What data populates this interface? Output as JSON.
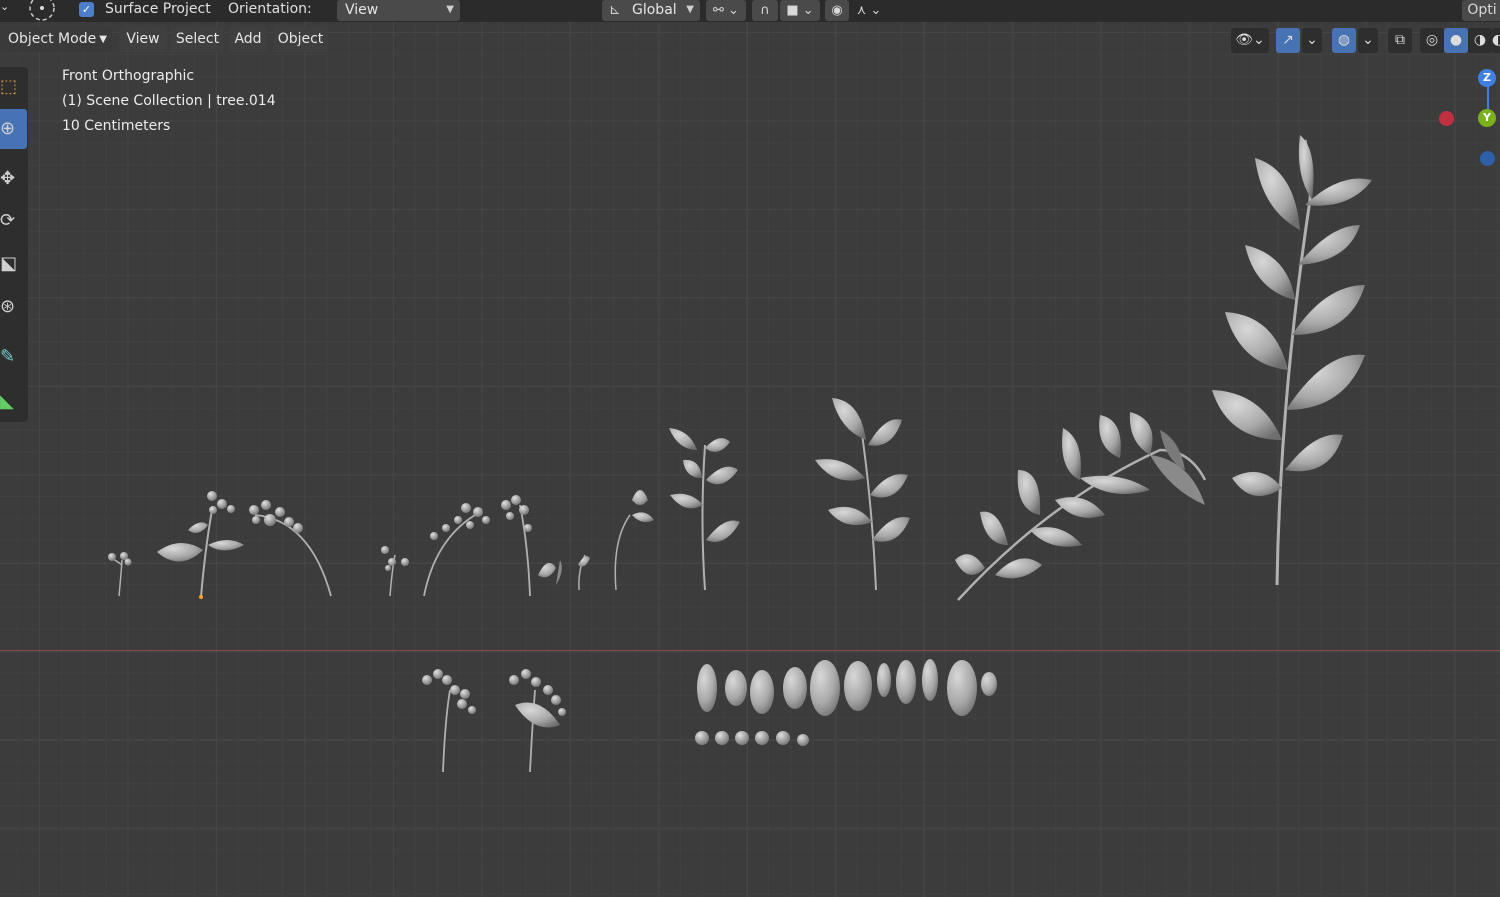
{
  "header": {
    "snap_toggle_label": "Surface Project",
    "snap_toggle_checked": true,
    "orientation_label": "Orientation:",
    "orientation_value": "View",
    "transform_orientation": "Global",
    "options_label": "Opti"
  },
  "mode_menu": {
    "mode": "Object Mode",
    "items": [
      "View",
      "Select",
      "Add",
      "Object"
    ]
  },
  "overlay_info": {
    "view_name": "Front Orthographic",
    "collection": "(1) Scene Collection | tree.014",
    "scale": "10 Centimeters"
  },
  "gizmo": {
    "z_label": "Z",
    "y_label": "Y",
    "colors": {
      "z": "#3f7fe0",
      "y": "#7bb01f",
      "x": "#c03040",
      "neg_y": "#2f5fa8"
    }
  },
  "tools": [
    "select-box",
    "cursor",
    "move",
    "rotate",
    "scale",
    "transform",
    "annotate",
    "measure"
  ],
  "colors": {
    "accent": "#4772b3",
    "x_axis": "#8a4a4a",
    "header_bg": "#2b2b2b",
    "viewport_bg": "#3c3c3c"
  }
}
